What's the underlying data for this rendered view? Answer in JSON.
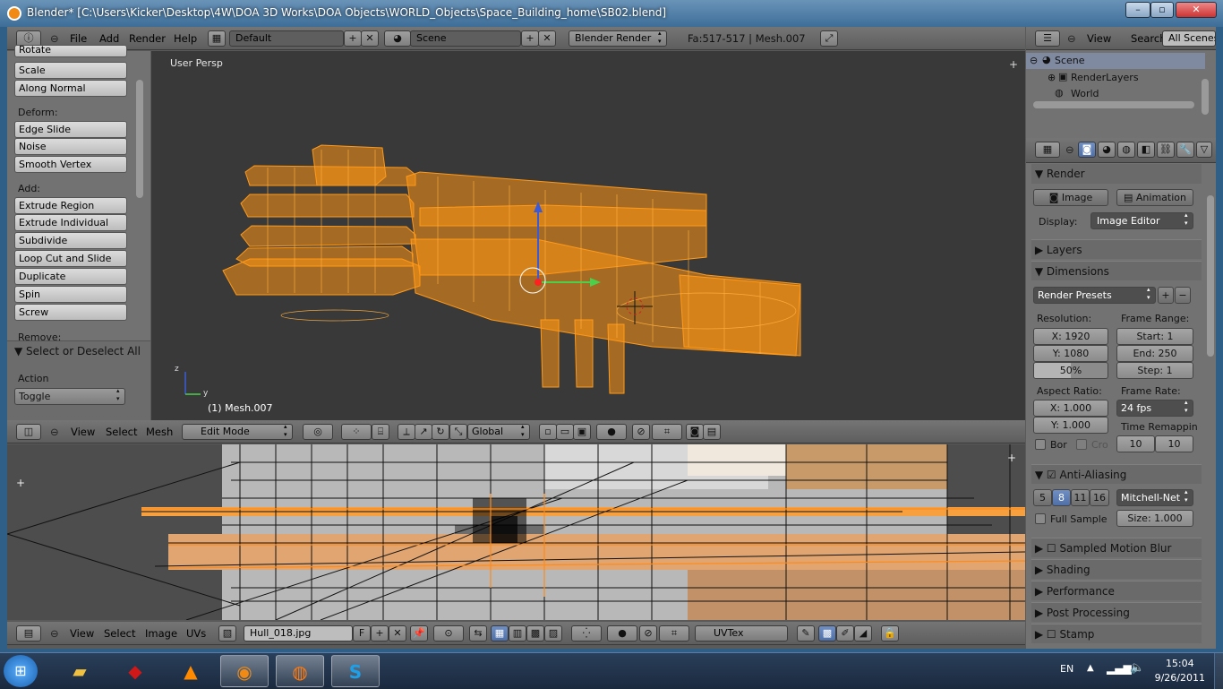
{
  "window": {
    "title": "Blender* [C:\\Users\\Kicker\\Desktop\\4W\\DOA 3D Works\\DOA Objects\\WORLD_Objects\\Space_Building_home\\SB02.blend]"
  },
  "info_header": {
    "menus": [
      "File",
      "Add",
      "Render",
      "Help"
    ],
    "layout": "Default",
    "scene": "Scene",
    "engine": "Blender Render",
    "stats": "Fa:517-517 | Mesh.007"
  },
  "toolshelf": {
    "top_clipped": "Rotate",
    "transform": [
      "Scale",
      "Along Normal"
    ],
    "deform_label": "Deform:",
    "deform": [
      "Edge Slide",
      "Noise",
      "Smooth Vertex"
    ],
    "add_label": "Add:",
    "add": [
      "Extrude Region",
      "Extrude Individual",
      "Subdivide",
      "Loop Cut and Slide",
      "Duplicate",
      "Spin",
      "Screw"
    ],
    "remove_label": "Remove:",
    "op_panel": "Select or Deselect All",
    "action_label": "Action",
    "action_value": "Toggle"
  },
  "viewport": {
    "view_name": "User Persp",
    "object_info": "(1) Mesh.007",
    "axis_y": "y",
    "axis_z": "z"
  },
  "view3d_header": {
    "menus": [
      "View",
      "Select",
      "Mesh"
    ],
    "mode": "Edit Mode",
    "orientation": "Global"
  },
  "uv_header": {
    "menus": [
      "View",
      "Select",
      "Image",
      "UVs"
    ],
    "image": "Hull_018.jpg",
    "fake_user": "F",
    "uv_map": "UVTex"
  },
  "outliner": {
    "menus": [
      "View",
      "Search"
    ],
    "filter": "All Scenes",
    "items": [
      "Scene",
      "RenderLayers",
      "World"
    ]
  },
  "properties": {
    "render_panel": "Render",
    "image_btn": "Image",
    "animation_btn": "Animation",
    "display_label": "Display:",
    "display_value": "Image Editor",
    "layers": "Layers",
    "dimensions": "Dimensions",
    "presets": "Render Presets",
    "resolution_label": "Resolution:",
    "res_x": "X: 1920",
    "res_y": "Y: 1080",
    "res_pct": "50%",
    "frame_range_label": "Frame Range:",
    "start": "Start: 1",
    "end": "End: 250",
    "step": "Step: 1",
    "aspect_label": "Aspect Ratio:",
    "asp_x": "X: 1.000",
    "asp_y": "Y: 1.000",
    "frame_rate_label": "Frame Rate:",
    "fps": "24 fps",
    "remap_label": "Time Remappin",
    "remap_old": "10",
    "remap_new": "10",
    "border": "Bor",
    "crop": "Cro",
    "anti_aliasing": "Anti-Aliasing",
    "aa_samples": [
      "5",
      "8",
      "11",
      "16"
    ],
    "aa_filter": "Mitchell-Net",
    "full_sample": "Full Sample",
    "size": "Size: 1.000",
    "sampled_motion_blur": "Sampled Motion Blur",
    "shading": "Shading",
    "performance": "Performance",
    "post_processing": "Post Processing",
    "stamp": "Stamp"
  },
  "taskbar": {
    "lang": "EN",
    "time": "15:04",
    "date": "9/26/2011"
  },
  "colors": {
    "mesh": "#ff9a1a",
    "viewport_bg": "#393939",
    "header": "#6b6b6b"
  }
}
